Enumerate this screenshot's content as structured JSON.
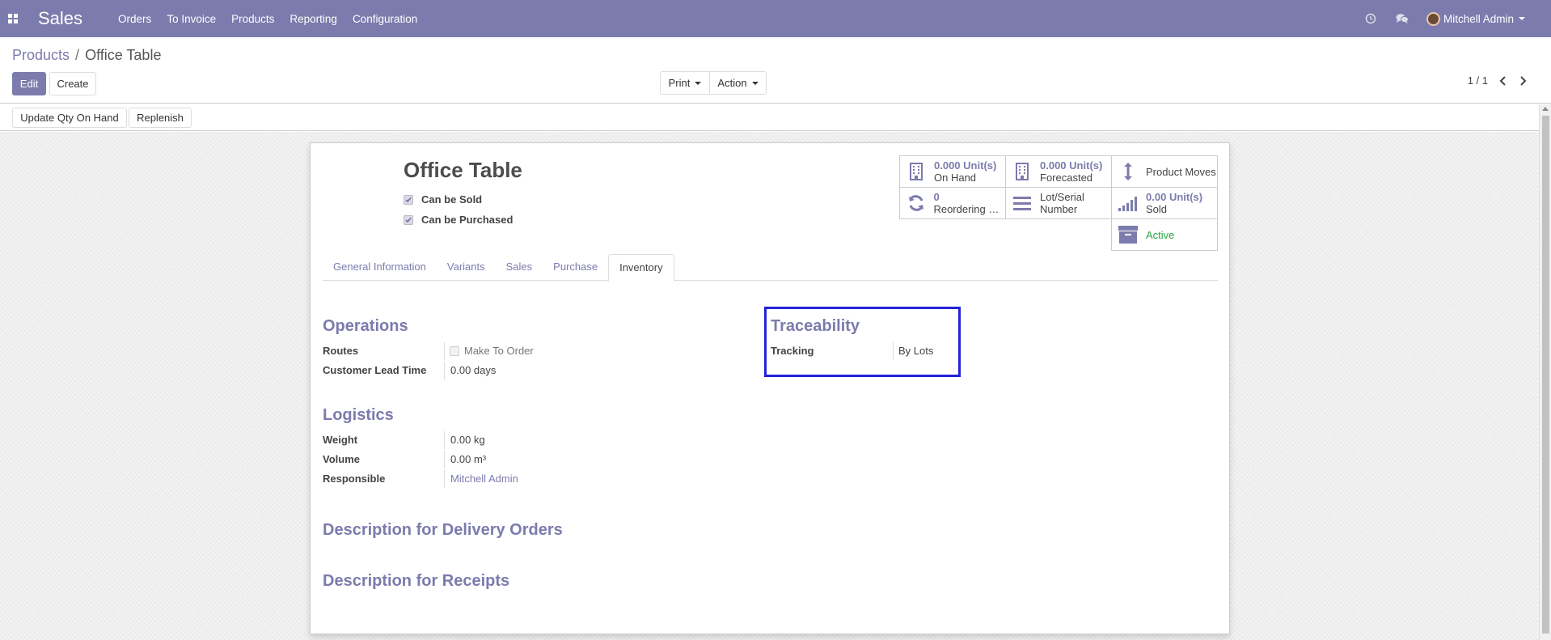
{
  "navbar": {
    "app_title": "Sales",
    "menu": [
      "Orders",
      "To Invoice",
      "Products",
      "Reporting",
      "Configuration"
    ],
    "user_name": "Mitchell Admin"
  },
  "breadcrumb": {
    "parent": "Products",
    "separator": "/",
    "current": "Office Table"
  },
  "toolbar": {
    "edit_label": "Edit",
    "create_label": "Create",
    "print_label": "Print",
    "action_label": "Action",
    "pager_text": "1 / 1"
  },
  "statusbar": {
    "update_qty_label": "Update Qty On Hand",
    "replenish_label": "Replenish"
  },
  "product": {
    "name": "Office Table",
    "can_be_sold_label": "Can be Sold",
    "can_be_sold": true,
    "can_be_purchased_label": "Can be Purchased",
    "can_be_purchased": true
  },
  "smart_buttons": {
    "on_hand_value": "0.000",
    "on_hand_unit": "Unit(s)",
    "on_hand_label": "On Hand",
    "forecasted_value": "0.000",
    "forecasted_unit": "Unit(s)",
    "forecasted_label": "Forecasted",
    "product_moves_label": "Product Moves",
    "reordering_value": "0",
    "reordering_label": "Reordering R…",
    "lot_serial_label_1": "Lot/Serial",
    "lot_serial_label_2": "Number",
    "sold_value": "0.00",
    "sold_unit": "Unit(s)",
    "sold_label": "Sold",
    "active_label": "Active"
  },
  "tabs": [
    "General Information",
    "Variants",
    "Sales",
    "Purchase",
    "Inventory"
  ],
  "active_tab": "Inventory",
  "operations": {
    "title": "Operations",
    "routes_label": "Routes",
    "routes_option": "Make To Order",
    "lead_time_label": "Customer Lead Time",
    "lead_time_value": "0.00 days"
  },
  "traceability": {
    "title": "Traceability",
    "tracking_label": "Tracking",
    "tracking_value": "By Lots"
  },
  "logistics": {
    "title": "Logistics",
    "weight_label": "Weight",
    "weight_value": "0.00",
    "weight_unit": "kg",
    "volume_label": "Volume",
    "volume_value": "0.00",
    "volume_unit": "m³",
    "responsible_label": "Responsible",
    "responsible_value": "Mitchell Admin"
  },
  "descriptions": {
    "delivery_title": "Description for Delivery Orders",
    "receipts_title": "Description for Receipts"
  },
  "colors": {
    "brand": "#7c7bad",
    "highlight": "#2323d9",
    "active": "#28a745"
  }
}
